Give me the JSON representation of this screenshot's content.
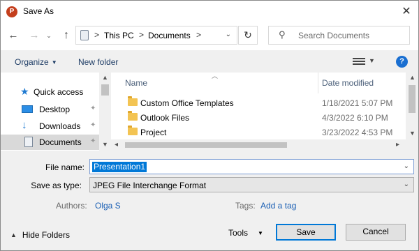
{
  "window": {
    "title": "Save As",
    "app_icon_letter": "P",
    "close_glyph": "✕"
  },
  "nav": {
    "back_glyph": "←",
    "forward_glyph": "→",
    "recent_glyph": "⌄",
    "up_glyph": "↑",
    "breadcrumbs": [
      "This PC",
      "Documents"
    ],
    "breadcrumb_sep": ">",
    "address_dropdown_glyph": "⌄",
    "refresh_glyph": "↻",
    "search_placeholder": "Search Documents",
    "search_glyph": "⚲"
  },
  "toolbar": {
    "organize_label": "Organize",
    "new_folder_label": "New folder",
    "help_label": "?"
  },
  "sidebar": {
    "items": [
      {
        "label": "Quick access",
        "icon": "star-icon"
      },
      {
        "label": "Desktop",
        "icon": "desktop-icon",
        "pinned": true
      },
      {
        "label": "Downloads",
        "icon": "download-icon",
        "pinned": true
      },
      {
        "label": "Documents",
        "icon": "documents-icon",
        "pinned": true,
        "selected": true
      }
    ],
    "quick_glyph": "★",
    "download_glyph": "↓",
    "pin_glyph": "📌"
  },
  "files": {
    "columns": {
      "name": "Name",
      "date": "Date modified"
    },
    "rows": [
      {
        "name": "Custom Office Templates",
        "date": "1/18/2021 5:07 PM"
      },
      {
        "name": "Outlook Files",
        "date": "4/3/2022 6:10 PM"
      },
      {
        "name": "Project",
        "date": "3/23/2022 4:53 PM"
      }
    ]
  },
  "form": {
    "file_name_label": "File name:",
    "file_name_value": "Presentation1",
    "save_type_label": "Save as type:",
    "save_type_value": "JPEG File Interchange Format",
    "authors_label": "Authors:",
    "authors_value": "Olga S",
    "tags_label": "Tags:",
    "tags_value": "Add a tag"
  },
  "footer": {
    "hide_folders_label": "Hide Folders",
    "tools_label": "Tools",
    "save_label": "Save",
    "cancel_label": "Cancel"
  },
  "colors": {
    "accent": "#0078d7",
    "link": "#1a5fb4",
    "app_icon": "#c43e1c",
    "folder": "#f3c453"
  }
}
